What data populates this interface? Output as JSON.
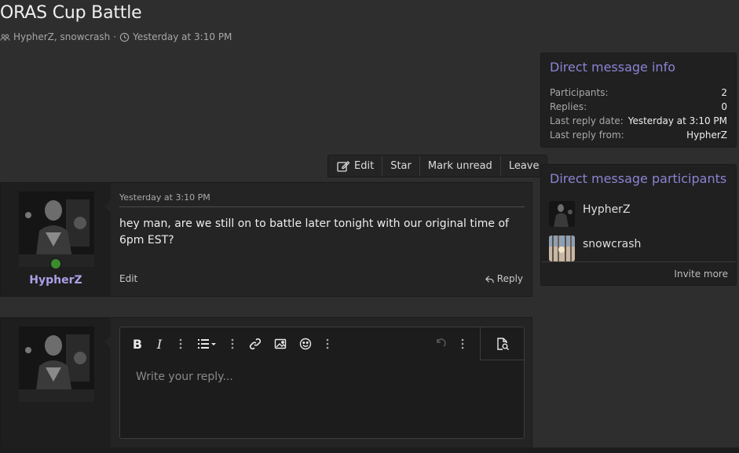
{
  "thread": {
    "title": "ORAS Cup Battle",
    "participants_text": "HypherZ, snowcrash",
    "separator": "·",
    "date": "Yesterday at 3:10 PM"
  },
  "actions": {
    "edit": "Edit",
    "star": "Star",
    "mark_unread": "Mark unread",
    "leave": "Leave"
  },
  "message": {
    "date": "Yesterday at 3:10 PM",
    "author": "HypherZ",
    "body": "hey man, are we still on to battle later tonight with our original time of 6pm EST?",
    "edit_label": "Edit",
    "reply_label": "Reply"
  },
  "editor": {
    "placeholder": "Write your reply..."
  },
  "sidebar": {
    "info": {
      "title": "Direct message info",
      "rows": [
        {
          "label": "Participants:",
          "value": "2"
        },
        {
          "label": "Replies:",
          "value": "0"
        },
        {
          "label": "Last reply date:",
          "value": "Yesterday at 3:10 PM"
        },
        {
          "label": "Last reply from:",
          "value": "HypherZ"
        }
      ]
    },
    "participants": {
      "title": "Direct message participants",
      "users": [
        {
          "name": "HypherZ"
        },
        {
          "name": "snowcrash"
        }
      ],
      "invite_label": "Invite more"
    }
  },
  "colors": {
    "accent": "#8a83d4",
    "username": "#a9a0e6",
    "online": "#3b8c2b",
    "background": "#2e2e2e"
  }
}
